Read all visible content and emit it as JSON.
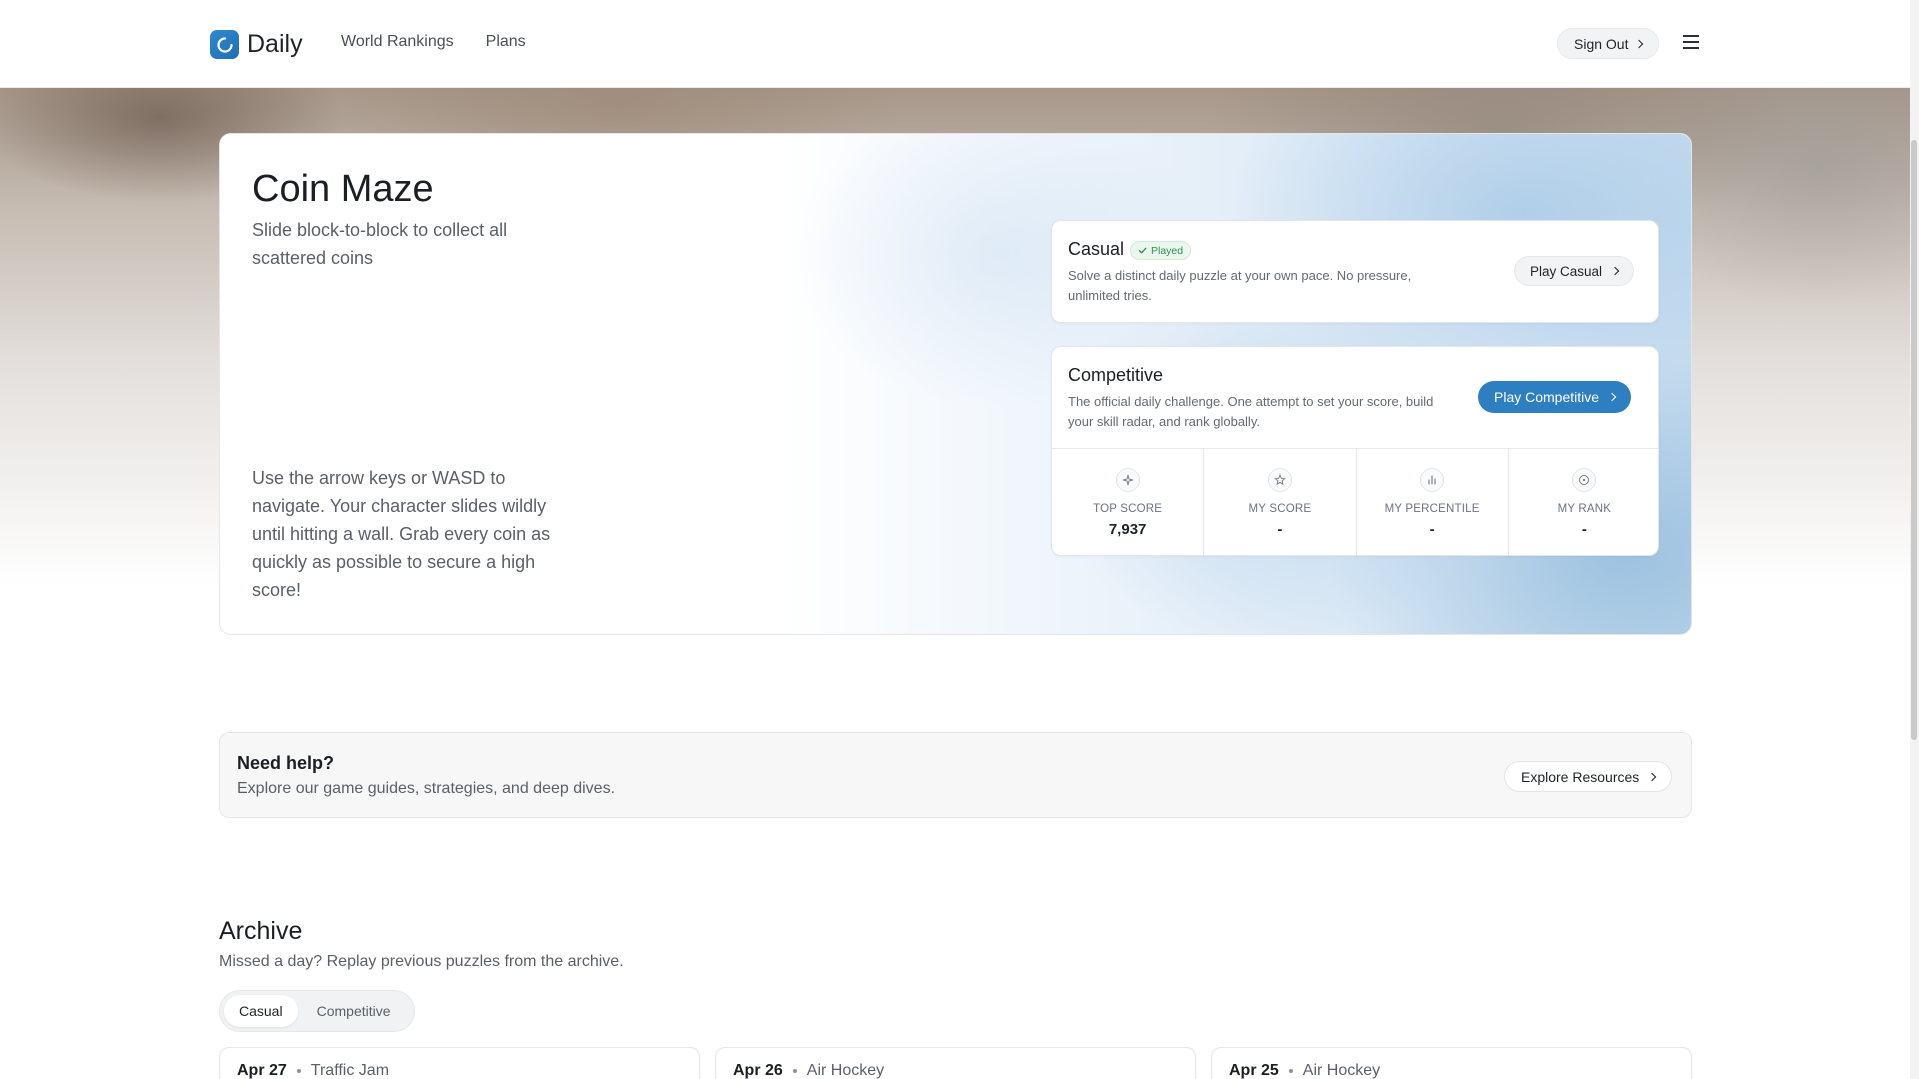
{
  "nav": {
    "logo_text": "Daily",
    "links": [
      "World Rankings",
      "Plans"
    ],
    "sign_out_label": "Sign Out"
  },
  "hero": {
    "title": "Coin Maze",
    "subtitle": "Slide block-to-block to collect all scattered coins",
    "instructions": "Use the arrow keys or WASD to navigate. Your character slides wildly until hitting a wall. Grab every coin as quickly as possible to secure a high score!"
  },
  "casual": {
    "title": "Casual",
    "badge": "Played",
    "description": "Solve a distinct daily puzzle at your own pace. No pressure, unlimited tries.",
    "button_label": "Play Casual"
  },
  "competitive": {
    "title": "Competitive",
    "description": "The official daily challenge. One attempt to set your score, build your skill radar, and rank globally.",
    "button_label": "Play Competitive",
    "stats": [
      {
        "icon": "sparkle-icon",
        "label": "TOP SCORE",
        "value": "7,937"
      },
      {
        "icon": "star-icon",
        "label": "MY SCORE",
        "value": "-"
      },
      {
        "icon": "bar-chart-icon",
        "label": "MY PERCENTILE",
        "value": "-"
      },
      {
        "icon": "target-icon",
        "label": "MY RANK",
        "value": "-"
      }
    ]
  },
  "help": {
    "title": "Need help?",
    "description": "Explore our game guides, strategies, and deep dives.",
    "button_label": "Explore Resources"
  },
  "archive": {
    "title": "Archive",
    "subtitle": "Missed a day? Replay previous puzzles from the archive.",
    "tabs": [
      "Casual",
      "Competitive"
    ],
    "active_tab": "Casual",
    "items": [
      {
        "date": "Apr 27",
        "game": "Traffic Jam"
      },
      {
        "date": "Apr 26",
        "game": "Air Hockey"
      },
      {
        "date": "Apr 25",
        "game": "Air Hockey"
      }
    ]
  },
  "colors": {
    "primary": "#2d7fc1",
    "played_badge": "#2f8f4e",
    "logo": "#1d6fb4"
  }
}
